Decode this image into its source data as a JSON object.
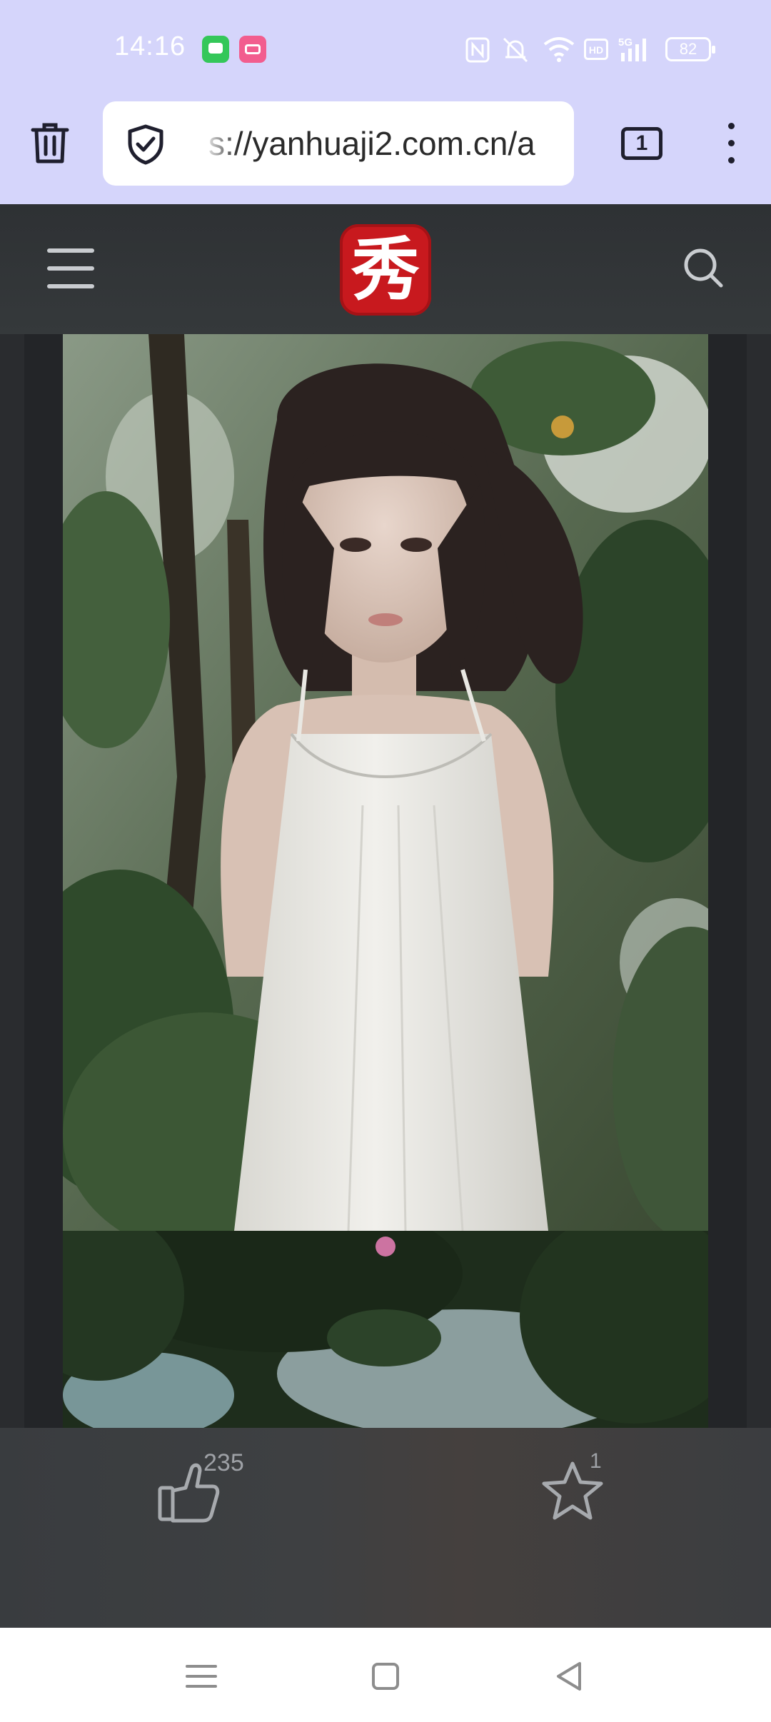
{
  "status_bar": {
    "time": "14:16",
    "battery": "82",
    "notifications": [
      "messages-icon",
      "bilibili-icon"
    ],
    "system_icons": [
      "nfc-icon",
      "mute-icon",
      "wifi-icon",
      "hd-icon",
      "5g-signal-icon",
      "battery-icon"
    ]
  },
  "browser": {
    "url": "s://yanhuaji2.com.cn/a",
    "tab_count": "1",
    "colors": {
      "toolbar_bg": "#d5d5fb",
      "icon": "#1f1f2e"
    }
  },
  "site_header": {
    "logo_text": "秀",
    "logo_color": "#c8191e"
  },
  "actions": {
    "like_count": "235",
    "favorite_count": "1"
  },
  "floating": {
    "dice_color": "#ea3f8d",
    "crown_color": "#f07a2a"
  },
  "nav_bar": {
    "icons": [
      "recents-icon",
      "home-icon",
      "back-icon"
    ]
  }
}
